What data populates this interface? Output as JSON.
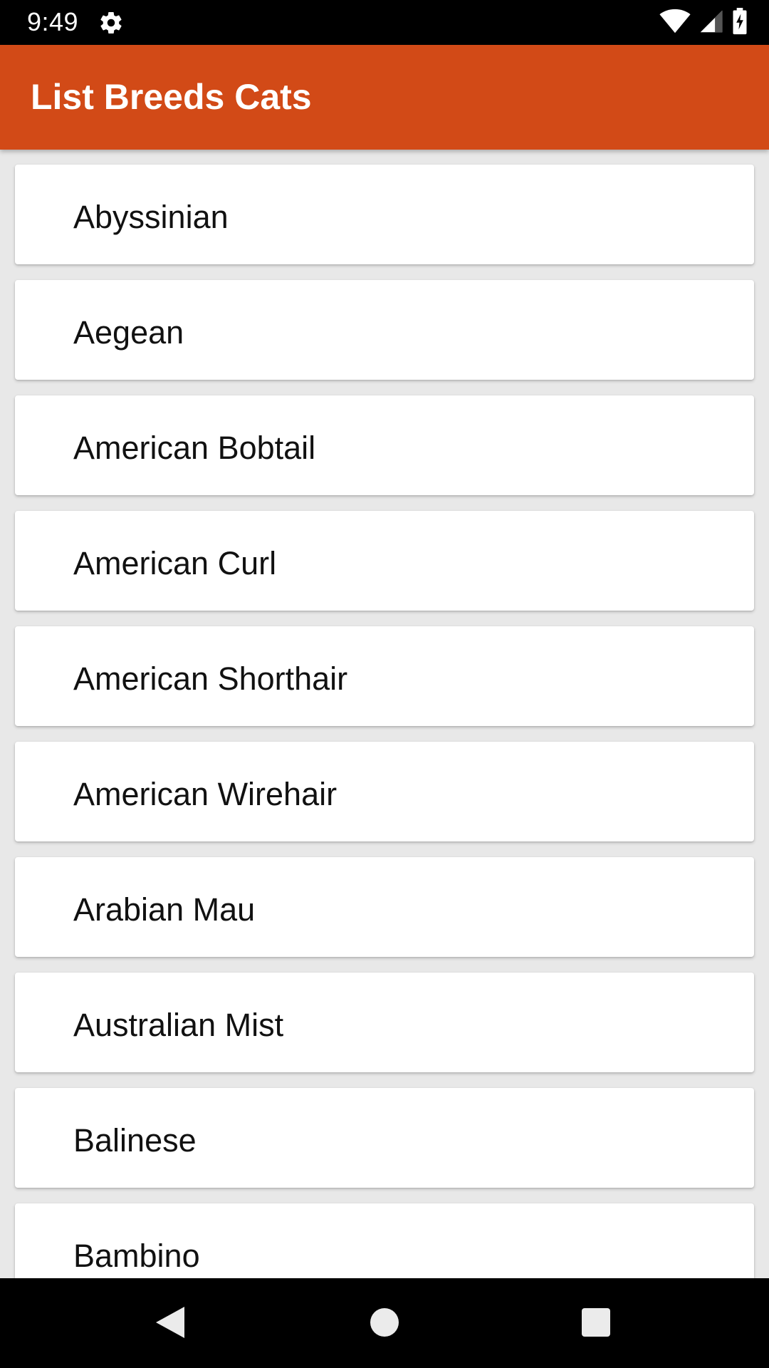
{
  "status_bar": {
    "time": "9:49",
    "icons": [
      "settings-icon",
      "wifi-icon",
      "cellular-signal-icon",
      "battery-charging-icon"
    ]
  },
  "app_bar": {
    "title": "List Breeds Cats",
    "color": "#d24a17"
  },
  "breeds": [
    {
      "name": "Abyssinian"
    },
    {
      "name": "Aegean"
    },
    {
      "name": "American Bobtail"
    },
    {
      "name": "American Curl"
    },
    {
      "name": "American Shorthair"
    },
    {
      "name": "American Wirehair"
    },
    {
      "name": "Arabian Mau"
    },
    {
      "name": "Australian Mist"
    },
    {
      "name": "Balinese"
    },
    {
      "name": "Bambino"
    }
  ],
  "nav_bar": {
    "buttons": [
      "back-icon",
      "home-icon",
      "recents-icon"
    ]
  }
}
